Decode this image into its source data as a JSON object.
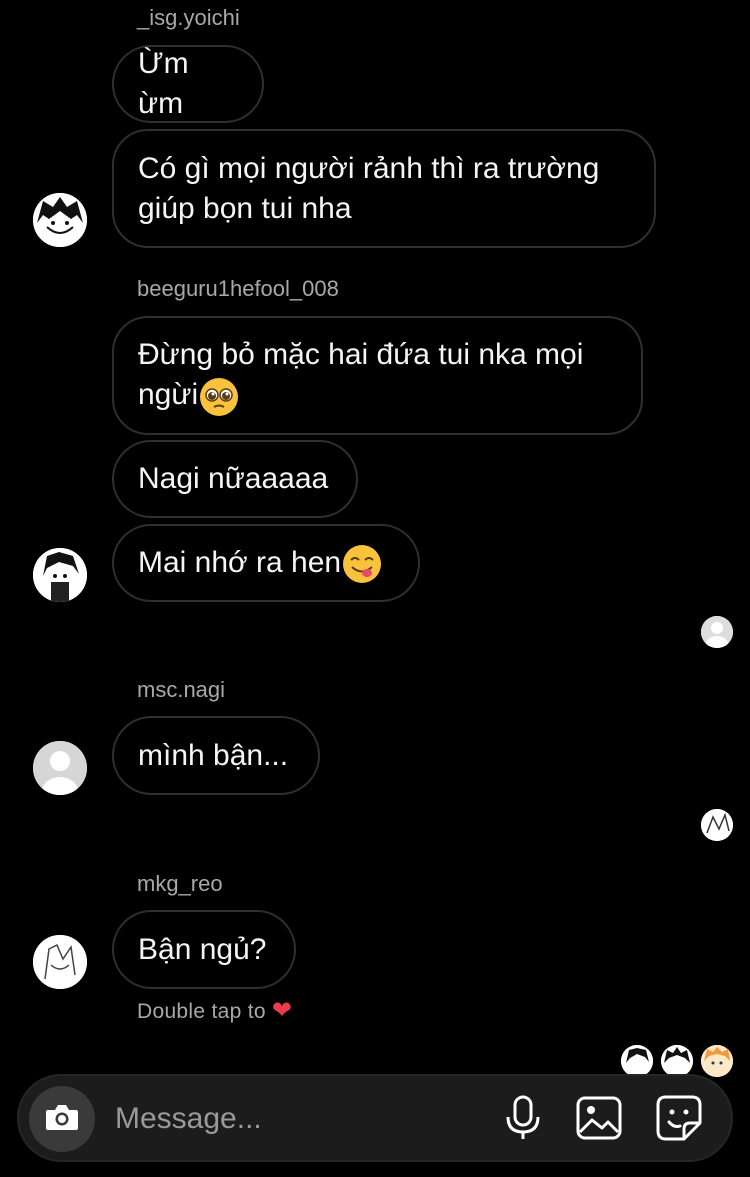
{
  "thread": {
    "groups": [
      {
        "username": "_isg.yoichi",
        "messages": [
          "Ừm ừm",
          "Có gì mọi người rảnh thì ra trường giúp bọn tui nha"
        ]
      },
      {
        "username": "beeguru1hefool_008",
        "messages": [
          "Đừng bỏ mặc hai đứa tui nka mọi ngừi",
          "Nagi nữaaaaa",
          "Mai nhớ ra hen"
        ]
      },
      {
        "username": "msc.nagi",
        "messages": [
          "mình bận..."
        ]
      },
      {
        "username": "mkg_reo",
        "messages": [
          "Bận ngủ?"
        ]
      }
    ],
    "line1": "Có gì mọi người rảnh thì ra trường",
    "line2": "giúp bọn tui nha",
    "line3": "Đừng bỏ mặc hai đứa tui nka mọi",
    "line4": "ngừi",
    "hint": "Double tap to"
  },
  "emojis": {
    "pleading": "pleading-face",
    "yum": "face-savoring-food",
    "heart": "red-heart"
  },
  "composer": {
    "placeholder": "Message..."
  },
  "colors": {
    "background": "#000000",
    "bubble_border": "#2f2f2f",
    "meta_text": "#a8a8a8",
    "heart": "#ed3a4d"
  }
}
